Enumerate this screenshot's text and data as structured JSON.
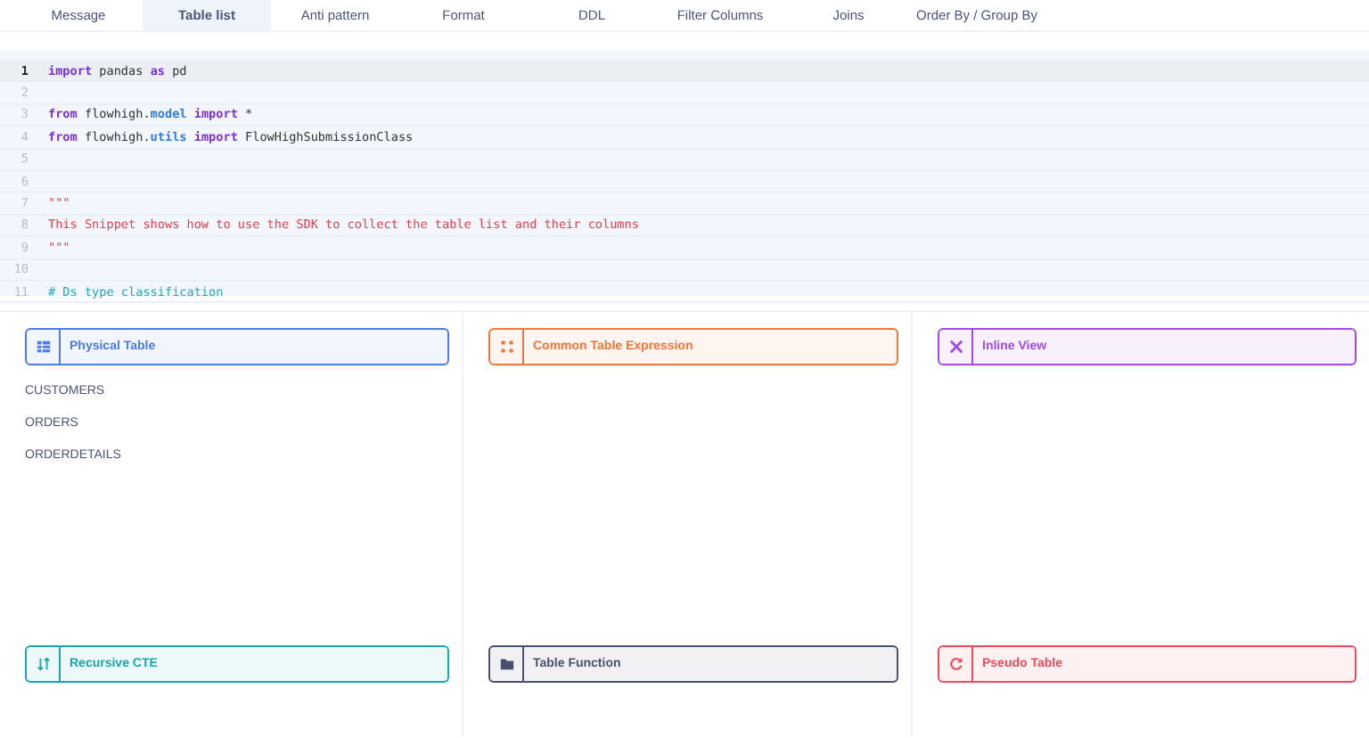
{
  "tabs": [
    {
      "label": "Message",
      "selected": false
    },
    {
      "label": "Table list",
      "selected": true
    },
    {
      "label": "Anti pattern",
      "selected": false
    },
    {
      "label": "Format",
      "selected": false
    },
    {
      "label": "DDL",
      "selected": false
    },
    {
      "label": "Filter Columns",
      "selected": false
    },
    {
      "label": "Joins",
      "selected": false
    },
    {
      "label": "Order By / Group By",
      "selected": false
    }
  ],
  "code": {
    "lines": [
      {
        "number": "1",
        "selected": true,
        "tokens": [
          {
            "kind": "keyword",
            "text": "import"
          },
          {
            "kind": "plain",
            "text": " pandas "
          },
          {
            "kind": "keyword",
            "text": "as"
          },
          {
            "kind": "plain",
            "text": " pd"
          }
        ]
      },
      {
        "number": "2",
        "selected": false
      },
      {
        "number": "3",
        "selected": false,
        "tokens": [
          {
            "kind": "keyword",
            "text": "from"
          },
          {
            "kind": "plain",
            "text": " flowhigh."
          },
          {
            "kind": "attr",
            "text": "model"
          },
          {
            "kind": "keyword",
            "text": " import"
          },
          {
            "kind": "plain",
            "text": " *"
          }
        ]
      },
      {
        "number": "4",
        "selected": false,
        "tokens": [
          {
            "kind": "keyword",
            "text": "from"
          },
          {
            "kind": "plain",
            "text": " flowhigh."
          },
          {
            "kind": "attr",
            "text": "utils"
          },
          {
            "kind": "keyword",
            "text": " import"
          },
          {
            "kind": "plain",
            "text": " FlowHighSubmissionClass"
          }
        ]
      },
      {
        "number": "5",
        "selected": false
      },
      {
        "number": "6",
        "selected": false
      },
      {
        "number": "7",
        "selected": false,
        "tokens": [
          {
            "kind": "string",
            "text": "\"\"\""
          }
        ]
      },
      {
        "number": "8",
        "selected": false,
        "tokens": [
          {
            "kind": "string",
            "text": "This Snippet shows how to use the SDK to collect the table list and their columns"
          }
        ]
      },
      {
        "number": "9",
        "selected": false,
        "tokens": [
          {
            "kind": "string",
            "text": "\"\"\""
          }
        ]
      },
      {
        "number": "10",
        "selected": false
      },
      {
        "number": "11",
        "selected": false,
        "tokens": [
          {
            "kind": "comment",
            "text": "# Ds type classification"
          }
        ]
      }
    ]
  },
  "cards": [
    {
      "title": "Physical Table",
      "color": "#4f7ae8",
      "items": [
        "CUSTOMERS",
        "ORDERS",
        "ORDERDETAILS"
      ]
    },
    {
      "title": "Common Table Expression",
      "color": "#f2773a"
    },
    {
      "title": "Inline View",
      "color": "#a24be6"
    },
    {
      "title": "Recursive CTE",
      "color": "#1aa6b0"
    },
    {
      "title": "Table Function",
      "color": "#4a5170"
    },
    {
      "title": "Pseudo Table",
      "color": "#ef4a5e"
    }
  ]
}
